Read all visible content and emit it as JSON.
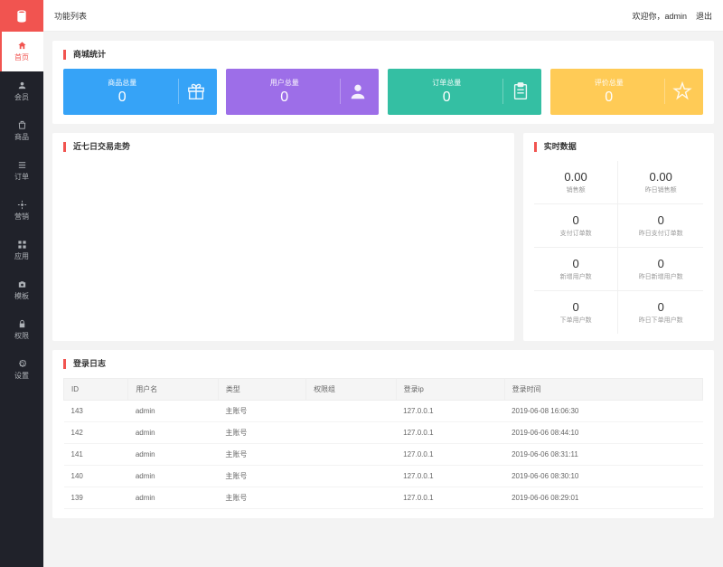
{
  "header": {
    "breadcrumb": "功能列表",
    "welcome": "欢迎你，admin",
    "logout": "退出"
  },
  "sidebar": {
    "items": [
      {
        "label": "首页"
      },
      {
        "label": "会员"
      },
      {
        "label": "商品"
      },
      {
        "label": "订单"
      },
      {
        "label": "营销"
      },
      {
        "label": "应用"
      },
      {
        "label": "模板"
      },
      {
        "label": "权限"
      },
      {
        "label": "设置"
      }
    ]
  },
  "stats": {
    "title": "商城统计",
    "cards": [
      {
        "label": "商品总量",
        "value": "0"
      },
      {
        "label": "用户总量",
        "value": "0"
      },
      {
        "label": "订单总量",
        "value": "0"
      },
      {
        "label": "评价总量",
        "value": "0"
      }
    ]
  },
  "chart": {
    "title": "近七日交易走势"
  },
  "realtime": {
    "title": "实时数据",
    "cells": [
      {
        "value": "0.00",
        "label": "销售额"
      },
      {
        "value": "0.00",
        "label": "昨日销售额"
      },
      {
        "value": "0",
        "label": "支付订单数"
      },
      {
        "value": "0",
        "label": "昨日支付订单数"
      },
      {
        "value": "0",
        "label": "新增用户数"
      },
      {
        "value": "0",
        "label": "昨日新增用户数"
      },
      {
        "value": "0",
        "label": "下单用户数"
      },
      {
        "value": "0",
        "label": "昨日下单用户数"
      }
    ]
  },
  "log": {
    "title": "登录日志",
    "headers": [
      "ID",
      "用户名",
      "类型",
      "权限组",
      "登录ip",
      "登录时间"
    ],
    "rows": [
      [
        "143",
        "admin",
        "主账号",
        "",
        "127.0.0.1",
        "2019-06-08 16:06:30"
      ],
      [
        "142",
        "admin",
        "主账号",
        "",
        "127.0.0.1",
        "2019-06-06 08:44:10"
      ],
      [
        "141",
        "admin",
        "主账号",
        "",
        "127.0.0.1",
        "2019-06-06 08:31:11"
      ],
      [
        "140",
        "admin",
        "主账号",
        "",
        "127.0.0.1",
        "2019-06-06 08:30:10"
      ],
      [
        "139",
        "admin",
        "主账号",
        "",
        "127.0.0.1",
        "2019-06-06 08:29:01"
      ]
    ]
  }
}
